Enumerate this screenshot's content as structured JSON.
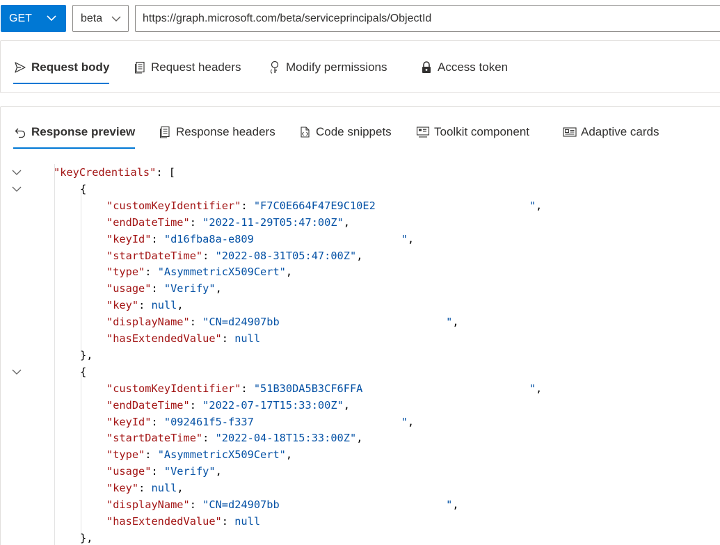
{
  "request_bar": {
    "method": "GET",
    "version": "beta",
    "url": "https://graph.microsoft.com/beta/serviceprincipals/ObjectId"
  },
  "request_tabs": [
    {
      "label": "Request body",
      "icon": "send-icon",
      "active": true
    },
    {
      "label": "Request headers",
      "icon": "headers-icon",
      "active": false
    },
    {
      "label": "Modify permissions",
      "icon": "permissions-icon",
      "active": false
    },
    {
      "label": "Access token",
      "icon": "lock-icon",
      "active": false
    }
  ],
  "response_tabs": [
    {
      "label": "Response preview",
      "icon": "undo-arrow-icon",
      "active": true
    },
    {
      "label": "Response headers",
      "icon": "headers-icon",
      "active": false
    },
    {
      "label": "Code snippets",
      "icon": "code-snippet-icon",
      "active": false
    },
    {
      "label": "Toolkit component",
      "icon": "toolkit-icon",
      "active": false
    },
    {
      "label": "Adaptive cards",
      "icon": "card-icon",
      "active": false
    }
  ],
  "colors": {
    "accent": "#0078d4",
    "json_key": "#a31515",
    "json_value": "#0451a5"
  },
  "response": {
    "root_key": "\"keyCredentials\"",
    "credentials": [
      {
        "customKeyIdentifier": "\"F7C0E664F47E9C10E2                        \"",
        "endDateTime": "\"2022-11-29T05:47:00Z\"",
        "keyId": "\"d16fba8a-e809                       \"",
        "startDateTime": "\"2022-08-31T05:47:00Z\"",
        "type": "\"AsymmetricX509Cert\"",
        "usage": "\"Verify\"",
        "key": "null",
        "displayName": "\"CN=d24907bb                          \"",
        "hasExtendedValue": "null"
      },
      {
        "customKeyIdentifier": "\"51B30DA5B3CF6FFA                          \"",
        "endDateTime": "\"2022-07-17T15:33:00Z\"",
        "keyId": "\"092461f5-f337                       \"",
        "startDateTime": "\"2022-04-18T15:33:00Z\"",
        "type": "\"AsymmetricX509Cert\"",
        "usage": "\"Verify\"",
        "key": "null",
        "displayName": "\"CN=d24907bb                          \"",
        "hasExtendedValue": "null"
      }
    ]
  }
}
